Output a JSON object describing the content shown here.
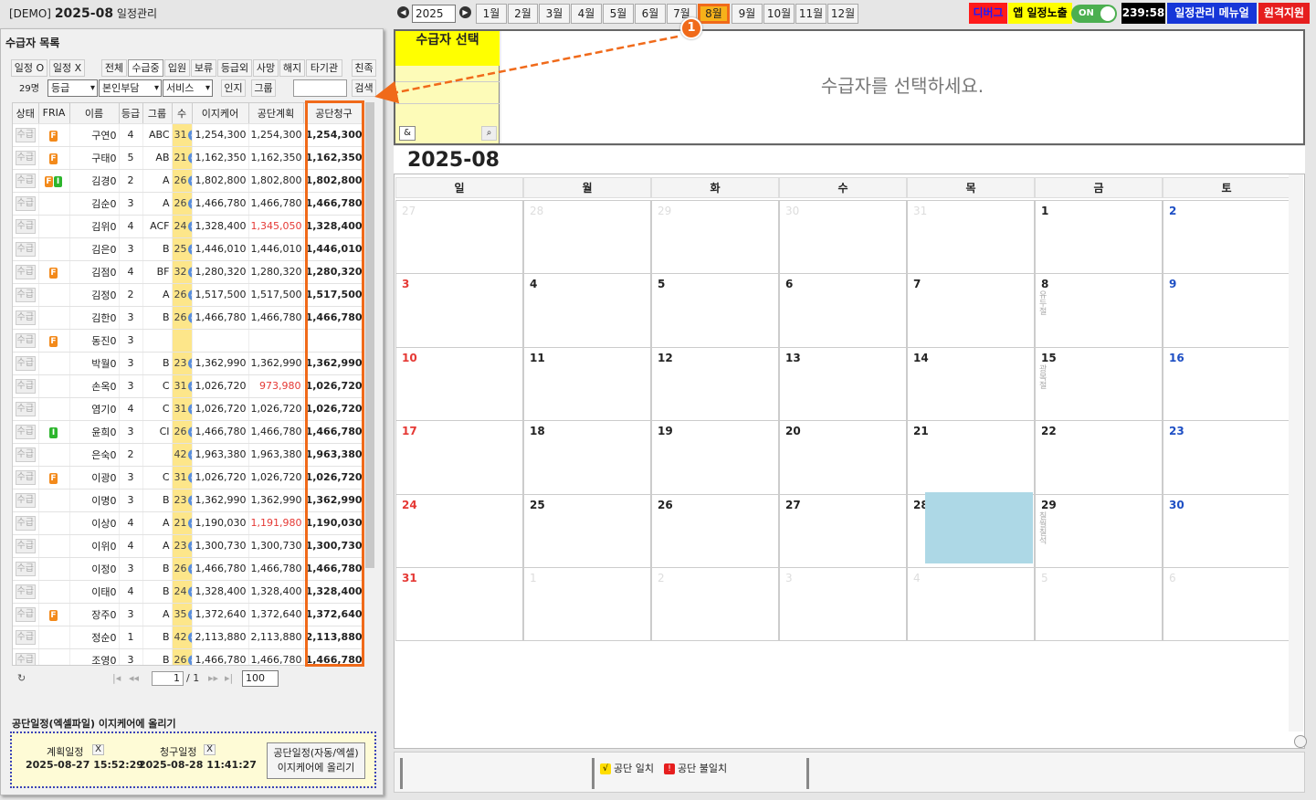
{
  "header": {
    "demo": "[DEMO]",
    "title": "2025-08",
    "subtitle": "일정관리",
    "year": "2025",
    "months": [
      "1월",
      "2월",
      "3월",
      "4월",
      "5월",
      "6월",
      "7월",
      "8월",
      "9월",
      "10월",
      "11월",
      "12월"
    ],
    "active_month_index": 7,
    "debug": "디버그",
    "app_schedule": "앱 일정노출",
    "toggle": "ON",
    "timer": "239:58",
    "manual": "일정관리 메뉴얼",
    "remote": "원격지원",
    "colors": {
      "active_month": "#f6b21a",
      "active_border": "#f06a1a",
      "debug_bg": "#ff1a1a",
      "app_bg": "#ffff00",
      "manual_bg": "#1636d8",
      "remote_bg": "#e61e1e"
    }
  },
  "callout": {
    "number": "1",
    "color": "#f06a1a"
  },
  "left": {
    "list_title": "수급자 목록",
    "filters": {
      "sched_o": "일정 O",
      "sched_x": "일정 X",
      "status_tabs": [
        "전체",
        "수급중",
        "입원",
        "보류",
        "등급외",
        "사망",
        "해지",
        "타기관",
        "친족"
      ],
      "active_status": "수급중",
      "count": "29명",
      "grade_select": "등급",
      "burden_select": "본인부담",
      "service_select": "서비스",
      "approve": "인지",
      "group": "그룹",
      "search": "검색",
      "search_placeholder": ""
    },
    "columns": [
      "상태",
      "FRIA",
      "이름",
      "등급",
      "그룹",
      "수",
      "이지케어",
      "공단계획",
      "공단청구"
    ],
    "rows": [
      {
        "status": "수급",
        "badges": [
          "F"
        ],
        "name": "구연0",
        "grade": "4",
        "group": "ABC",
        "count": "31",
        "check": true,
        "ez": "1,254,300",
        "plan": "1,254,300",
        "plan_red": false,
        "claim": "1,254,300"
      },
      {
        "status": "수급",
        "badges": [
          "F"
        ],
        "name": "구태0",
        "grade": "5",
        "group": "AB",
        "count": "21",
        "check": true,
        "ez": "1,162,350",
        "plan": "1,162,350",
        "plan_red": false,
        "claim": "1,162,350"
      },
      {
        "status": "수급",
        "badges": [
          "F",
          "I"
        ],
        "name": "김경0",
        "grade": "2",
        "group": "A",
        "count": "26",
        "check": true,
        "ez": "1,802,800",
        "plan": "1,802,800",
        "plan_red": false,
        "claim": "1,802,800"
      },
      {
        "status": "수급",
        "badges": [],
        "name": "김순0",
        "grade": "3",
        "group": "A",
        "count": "26",
        "check": true,
        "ez": "1,466,780",
        "plan": "1,466,780",
        "plan_red": false,
        "claim": "1,466,780"
      },
      {
        "status": "수급",
        "badges": [],
        "name": "김위0",
        "grade": "4",
        "group": "ACF",
        "count": "24",
        "check": true,
        "ez": "1,328,400",
        "plan": "1,345,050",
        "plan_red": true,
        "claim": "1,328,400"
      },
      {
        "status": "수급",
        "badges": [],
        "name": "김은0",
        "grade": "3",
        "group": "B",
        "count": "25",
        "check": true,
        "ez": "1,446,010",
        "plan": "1,446,010",
        "plan_red": false,
        "claim": "1,446,010"
      },
      {
        "status": "수급",
        "badges": [
          "F"
        ],
        "name": "김점0",
        "grade": "4",
        "group": "BF",
        "count": "32",
        "check": true,
        "ez": "1,280,320",
        "plan": "1,280,320",
        "plan_red": false,
        "claim": "1,280,320"
      },
      {
        "status": "수급",
        "badges": [],
        "name": "김정0",
        "grade": "2",
        "group": "A",
        "count": "26",
        "check": true,
        "ez": "1,517,500",
        "plan": "1,517,500",
        "plan_red": false,
        "claim": "1,517,500"
      },
      {
        "status": "수급",
        "badges": [],
        "name": "김한0",
        "grade": "3",
        "group": "B",
        "count": "26",
        "check": true,
        "ez": "1,466,780",
        "plan": "1,466,780",
        "plan_red": false,
        "claim": "1,466,780"
      },
      {
        "status": "수급",
        "badges": [
          "F"
        ],
        "name": "동진0",
        "grade": "3",
        "group": "",
        "count": "",
        "check": false,
        "ez": "",
        "plan": "",
        "plan_red": false,
        "claim": ""
      },
      {
        "status": "수급",
        "badges": [],
        "name": "박월0",
        "grade": "3",
        "group": "B",
        "count": "23",
        "check": true,
        "ez": "1,362,990",
        "plan": "1,362,990",
        "plan_red": false,
        "claim": "1,362,990"
      },
      {
        "status": "수급",
        "badges": [],
        "name": "손옥0",
        "grade": "3",
        "group": "C",
        "count": "31",
        "check": true,
        "ez": "1,026,720",
        "plan": "973,980",
        "plan_red": true,
        "claim": "1,026,720"
      },
      {
        "status": "수급",
        "badges": [],
        "name": "염기0",
        "grade": "4",
        "group": "C",
        "count": "31",
        "check": true,
        "ez": "1,026,720",
        "plan": "1,026,720",
        "plan_red": false,
        "claim": "1,026,720"
      },
      {
        "status": "수급",
        "badges": [
          "I"
        ],
        "name": "윤희0",
        "grade": "3",
        "group": "CI",
        "count": "26",
        "check": true,
        "ez": "1,466,780",
        "plan": "1,466,780",
        "plan_red": false,
        "claim": "1,466,780"
      },
      {
        "status": "수급",
        "badges": [],
        "name": "은숙0",
        "grade": "2",
        "group": "",
        "count": "42",
        "check": true,
        "ez": "1,963,380",
        "plan": "1,963,380",
        "plan_red": false,
        "claim": "1,963,380"
      },
      {
        "status": "수급",
        "badges": [
          "F"
        ],
        "name": "이광0",
        "grade": "3",
        "group": "C",
        "count": "31",
        "check": true,
        "ez": "1,026,720",
        "plan": "1,026,720",
        "plan_red": false,
        "claim": "1,026,720"
      },
      {
        "status": "수급",
        "badges": [],
        "name": "이명0",
        "grade": "3",
        "group": "B",
        "count": "23",
        "check": true,
        "ez": "1,362,990",
        "plan": "1,362,990",
        "plan_red": false,
        "claim": "1,362,990"
      },
      {
        "status": "수급",
        "badges": [],
        "name": "이상0",
        "grade": "4",
        "group": "A",
        "count": "21",
        "check": true,
        "ez": "1,190,030",
        "plan": "1,191,980",
        "plan_red": true,
        "claim": "1,190,030"
      },
      {
        "status": "수급",
        "badges": [],
        "name": "이위0",
        "grade": "4",
        "group": "A",
        "count": "23",
        "check": true,
        "ez": "1,300,730",
        "plan": "1,300,730",
        "plan_red": false,
        "claim": "1,300,730"
      },
      {
        "status": "수급",
        "badges": [],
        "name": "이정0",
        "grade": "3",
        "group": "B",
        "count": "26",
        "check": true,
        "ez": "1,466,780",
        "plan": "1,466,780",
        "plan_red": false,
        "claim": "1,466,780"
      },
      {
        "status": "수급",
        "badges": [],
        "name": "이태0",
        "grade": "4",
        "group": "B",
        "count": "24",
        "check": true,
        "ez": "1,328,400",
        "plan": "1,328,400",
        "plan_red": false,
        "claim": "1,328,400"
      },
      {
        "status": "수급",
        "badges": [
          "F"
        ],
        "name": "장주0",
        "grade": "3",
        "group": "A",
        "count": "35",
        "check": true,
        "ez": "1,372,640",
        "plan": "1,372,640",
        "plan_red": false,
        "claim": "1,372,640"
      },
      {
        "status": "수급",
        "badges": [],
        "name": "정순0",
        "grade": "1",
        "group": "B",
        "count": "42",
        "check": true,
        "ez": "2,113,880",
        "plan": "2,113,880",
        "plan_red": false,
        "claim": "2,113,880"
      },
      {
        "status": "수급",
        "badges": [],
        "name": "조영0",
        "grade": "3",
        "group": "B",
        "count": "26",
        "check": true,
        "ez": "1,466,780",
        "plan": "1,466,780",
        "plan_red": false,
        "claim": "1,466,780"
      }
    ],
    "pager": {
      "page": "1",
      "total": "/ 1",
      "page_size": "100",
      "first": "|◂",
      "prev": "◂◂",
      "next": "▸▸",
      "last": "▸|",
      "refresh": "↻"
    },
    "upload": {
      "title": "공단일정(엑셀파일) 이지케어에 올리기",
      "plan_label": "계획일정",
      "plan_ts": "2025-08-27 15:52:29",
      "claim_label": "청구일정",
      "claim_ts": "2025-08-28 11:41:27",
      "x": "X",
      "button_line1": "공단일정(자동/엑셀)",
      "button_line2": "이지케어에 올리기"
    }
  },
  "right": {
    "selector_title": "수급자 선택",
    "amp": "&",
    "placeholder": "수급자를 선택하세요.",
    "calendar": {
      "month_label": "2025-08",
      "weekdays": [
        "일",
        "월",
        "화",
        "수",
        "목",
        "금",
        "토"
      ],
      "weeks": [
        [
          "27",
          "28",
          "29",
          "30",
          "31",
          "1",
          "2"
        ],
        [
          "3",
          "4",
          "5",
          "6",
          "7",
          "8",
          "9"
        ],
        [
          "10",
          "11",
          "12",
          "13",
          "14",
          "15",
          "16"
        ],
        [
          "17",
          "18",
          "19",
          "20",
          "21",
          "22",
          "23"
        ],
        [
          "24",
          "25",
          "26",
          "27",
          "28",
          "29",
          "30"
        ],
        [
          "31",
          "1",
          "2",
          "3",
          "4",
          "5",
          "6"
        ]
      ],
      "other_month": [
        [
          0,
          0
        ],
        [
          0,
          1
        ],
        [
          0,
          2
        ],
        [
          0,
          3
        ],
        [
          0,
          4
        ],
        [
          5,
          1
        ],
        [
          5,
          2
        ],
        [
          5,
          3
        ],
        [
          5,
          4
        ],
        [
          5,
          5
        ],
        [
          5,
          6
        ]
      ],
      "events": [
        {
          "week": 1,
          "day": 5,
          "text": "유두절"
        },
        {
          "week": 2,
          "day": 5,
          "text": "광복절"
        },
        {
          "week": 4,
          "day": 5,
          "text": "칠월칠석"
        }
      ],
      "selection_color": "#add8e6"
    },
    "legend": {
      "match": "공단 일치",
      "mismatch": "공단 불일치",
      "match_icon": "√",
      "mismatch_icon": "!"
    }
  }
}
